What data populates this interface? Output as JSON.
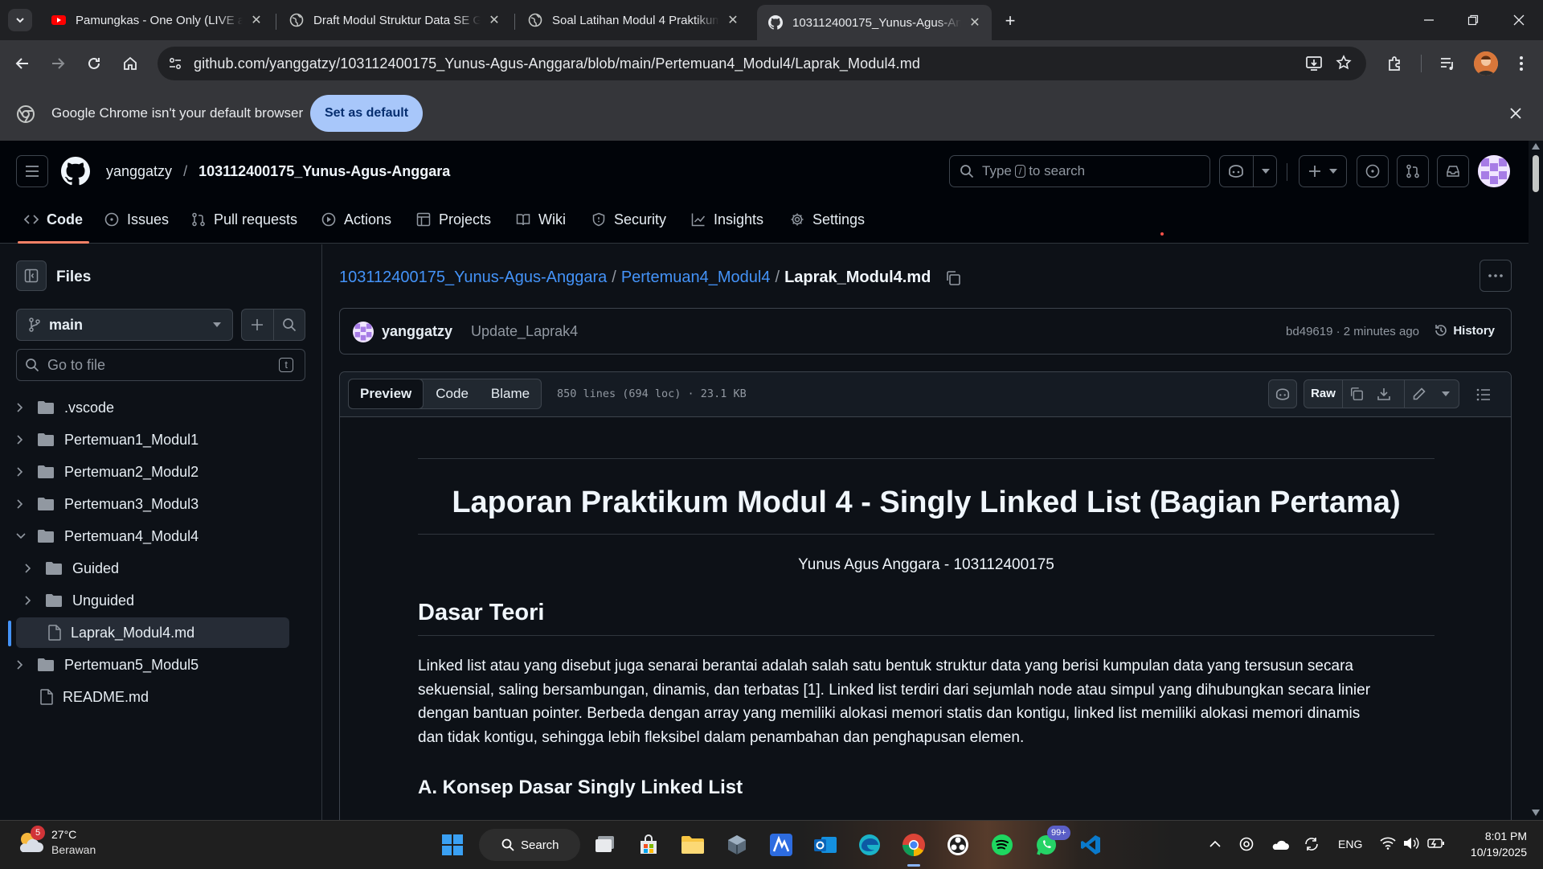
{
  "browser": {
    "tabs": [
      {
        "title": "Pamungkas - One Only (LIVE at",
        "favicon": "youtube-icon"
      },
      {
        "title": "Draft Modul Struktur Data SE G",
        "favicon": "globe-icon"
      },
      {
        "title": "Soal Latihan Modul 4 Praktikum",
        "favicon": "globe-icon"
      },
      {
        "title": "103112400175_Yunus-Agus-An",
        "favicon": "github-icon"
      }
    ],
    "active_tab": 3,
    "url": "github.com/yanggatzy/103112400175_Yunus-Agus-Anggara/blob/main/Pertemuan4_Modul4/Laprak_Modul4.md",
    "infobar": {
      "message": "Google Chrome isn't your default browser",
      "button": "Set as default"
    }
  },
  "github": {
    "owner": "yanggatzy",
    "separator": "/",
    "repo": "103112400175_Yunus-Agus-Anggara",
    "search": {
      "before": "Type",
      "key": "/",
      "after": "to search"
    },
    "nav": [
      {
        "label": "Code",
        "icon": "code-icon"
      },
      {
        "label": "Issues",
        "icon": "issue-icon"
      },
      {
        "label": "Pull requests",
        "icon": "pull-request-icon"
      },
      {
        "label": "Actions",
        "icon": "play-icon"
      },
      {
        "label": "Projects",
        "icon": "table-icon"
      },
      {
        "label": "Wiki",
        "icon": "book-icon"
      },
      {
        "label": "Security",
        "icon": "shield-icon"
      },
      {
        "label": "Insights",
        "icon": "graph-icon"
      },
      {
        "label": "Settings",
        "icon": "gear-icon"
      }
    ],
    "sidebar": {
      "title": "Files",
      "branch": "main",
      "goto_placeholder": "Go to file",
      "goto_key": "t",
      "tree": [
        {
          "name": ".vscode",
          "type": "folder",
          "expanded": false,
          "depth": 0
        },
        {
          "name": "Pertemuan1_Modul1",
          "type": "folder",
          "expanded": false,
          "depth": 0
        },
        {
          "name": "Pertemuan2_Modul2",
          "type": "folder",
          "expanded": false,
          "depth": 0
        },
        {
          "name": "Pertemuan3_Modul3",
          "type": "folder",
          "expanded": false,
          "depth": 0
        },
        {
          "name": "Pertemuan4_Modul4",
          "type": "folder",
          "expanded": true,
          "depth": 0
        },
        {
          "name": "Guided",
          "type": "folder",
          "expanded": false,
          "depth": 1
        },
        {
          "name": "Unguided",
          "type": "folder",
          "expanded": false,
          "depth": 1
        },
        {
          "name": "Laprak_Modul4.md",
          "type": "file",
          "selected": true,
          "depth": 1
        },
        {
          "name": "Pertemuan5_Modul5",
          "type": "folder",
          "expanded": false,
          "depth": 0
        },
        {
          "name": "README.md",
          "type": "file",
          "depth": 0
        }
      ]
    },
    "breadcrumb": {
      "repo": "103112400175_Yunus-Agus-Anggara",
      "folder": "Pertemuan4_Modul4",
      "file": "Laprak_Modul4.md",
      "sep": "/"
    },
    "commit": {
      "author": "yanggatzy",
      "message": "Update_Laprak4",
      "meta": "bd49619 · 2 minutes ago",
      "history": "History"
    },
    "file_toolbar": {
      "tabs": [
        "Preview",
        "Code",
        "Blame"
      ],
      "active": "Preview",
      "info": "850 lines (694 loc) · 23.1 KB",
      "raw": "Raw"
    },
    "doc": {
      "h1": "Laporan Praktikum Modul 4 - Singly Linked List (Bagian Pertama)",
      "author_line": "Yunus Agus Anggara - 103112400175",
      "h2": "Dasar Teori",
      "para_lines": [
        "Linked list atau yang disebut juga senarai berantai adalah salah satu bentuk struktur data yang berisi kumpulan data yang tersusun secara",
        "sekuensial, saling bersambungan, dinamis, dan terbatas [1]. Linked list terdiri dari sejumlah node atau simpul yang dihubungkan secara linier",
        "dengan bantuan pointer. Berbeda dengan array yang memiliki alokasi memori statis dan kontigu, linked list memiliki alokasi memori dinamis",
        "dan tidak kontigu, sehingga lebih fleksibel dalam penambahan dan penghapusan elemen."
      ],
      "h3": "A. Konsep Dasar Singly Linked List"
    }
  },
  "taskbar": {
    "weather": {
      "temp": "27°C",
      "desc": "Berawan",
      "badge": "5"
    },
    "search": "Search",
    "whatsapp_badge": "99+",
    "lang": "ENG",
    "time": "8:01 PM",
    "date": "10/19/2025"
  }
}
